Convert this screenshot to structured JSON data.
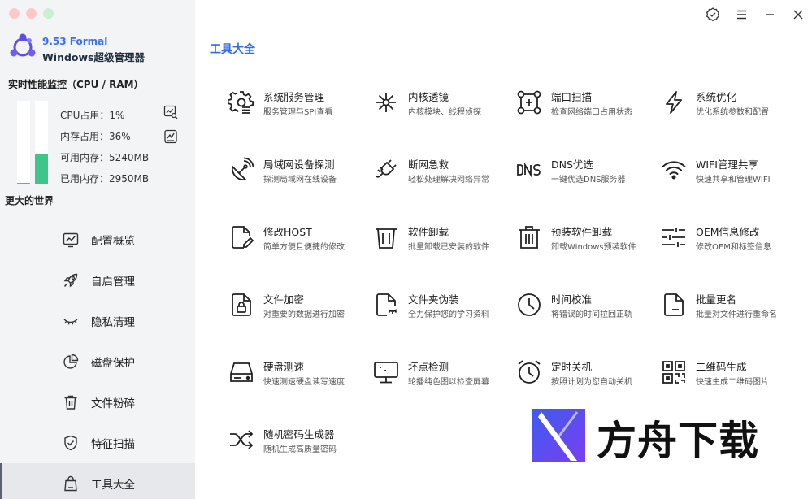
{
  "app": {
    "version": "9.53 Formal",
    "name": "Windows超级管理器"
  },
  "monitor": {
    "title": "实时性能监控（CPU / RAM）",
    "cpu_label": "CPU占用：1%",
    "mem_label": "内存占用：36%",
    "avail_label": "可用内存：5240MB",
    "used_label": "已用内存：2950MB",
    "cpu_fraction": 0.01,
    "mem_fraction": 0.36
  },
  "slogan": "更大的世界",
  "nav": [
    {
      "label": "配置概览",
      "icon": "chart-monitor-icon"
    },
    {
      "label": "自启管理",
      "icon": "rocket-icon"
    },
    {
      "label": "隐私清理",
      "icon": "eye-closed-icon"
    },
    {
      "label": "磁盘保护",
      "icon": "pie-chart-icon"
    },
    {
      "label": "文件粉碎",
      "icon": "trash-icon"
    },
    {
      "label": "特征扫描",
      "icon": "shield-check-icon"
    },
    {
      "label": "工具大全",
      "icon": "bag-icon",
      "active": true
    }
  ],
  "section_title": "工具大全",
  "tools": [
    {
      "name": "系统服务管理",
      "desc": "服务管理与SPI查看",
      "icon": "gear-service-icon"
    },
    {
      "name": "内核透镜",
      "desc": "内核模块、线程侦探",
      "icon": "kernel-icon"
    },
    {
      "name": "端口扫描",
      "desc": "检查网络端口占用状态",
      "icon": "port-scan-icon"
    },
    {
      "name": "系统优化",
      "desc": "优化系统参数和配置",
      "icon": "lightning-icon"
    },
    {
      "name": "局域网设备探测",
      "desc": "探测局域网在线设备",
      "icon": "radar-dish-icon"
    },
    {
      "name": "断网急救",
      "desc": "轻松处理解决网络异常",
      "icon": "plug-icon"
    },
    {
      "name": "DNS优选",
      "desc": "一键优选DNS服务器",
      "icon": "dns-icon"
    },
    {
      "name": "WIFI管理共享",
      "desc": "快速共享和管理WIFI",
      "icon": "wifi-icon"
    },
    {
      "name": "修改HOST",
      "desc": "简单方便且便捷的修改",
      "icon": "edit-file-icon"
    },
    {
      "name": "软件卸载",
      "desc": "批量卸载已安装的软件",
      "icon": "bin-icon"
    },
    {
      "name": "预装软件卸载",
      "desc": "卸载Windows预装软件",
      "icon": "trash-preinstall-icon"
    },
    {
      "name": "OEM信息修改",
      "desc": "修改OEM和标签信息",
      "icon": "sliders-icon"
    },
    {
      "name": "文件加密",
      "desc": "对重要的数据进行加密",
      "icon": "lock-file-icon"
    },
    {
      "name": "文件夹伪装",
      "desc": "全力保护您的学习资料",
      "icon": "disguise-file-icon"
    },
    {
      "name": "时间校准",
      "desc": "将错误的时间拉回正轨",
      "icon": "clock-icon"
    },
    {
      "name": "批量更名",
      "desc": "批量对文件进行重命名",
      "icon": "rename-file-icon"
    },
    {
      "name": "硬盘测速",
      "desc": "快速测速硬盘读写速度",
      "icon": "hard-drive-icon"
    },
    {
      "name": "坏点检测",
      "desc": "轮播纯色图以检查屏幕",
      "icon": "monitor-icon"
    },
    {
      "name": "定时关机",
      "desc": "按照计划为您自动关机",
      "icon": "alarm-clock-icon"
    },
    {
      "name": "二维码生成",
      "desc": "快速生成二维码图片",
      "icon": "qr-code-icon"
    },
    {
      "name": "随机密码生成器",
      "desc": "随机生成高质量密码",
      "icon": "shuffle-icon"
    }
  ],
  "watermark": {
    "text": "方舟下载"
  },
  "colors": {
    "accent": "#2f6cf0",
    "bar_fill": "#3ec58a",
    "sidebar_bg": "#f3f4f6"
  }
}
